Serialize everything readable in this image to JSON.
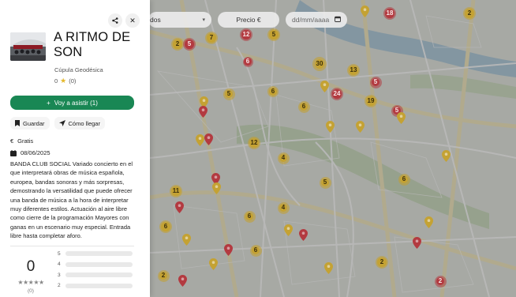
{
  "event": {
    "title": "A RITMO DE SON",
    "venue": "Cúpula Geodésica",
    "rating_count_label": "0",
    "reviews_label": "(0)",
    "attend_label": "Voy a asistir (1)",
    "save_label": "Guardar",
    "directions_label": "Cómo llegar",
    "price": "Gratis",
    "date": "08/06/2025",
    "description": "BANDA CLUB SOCIAL Variado concierto en el que interpretará obras de música española, europea, bandas sonoras y más sorpresas, demostrando la versatilidad que puede ofrecer una banda de música a la hora de interpretar muy diferentes estilos. Actuación al aire libre como cierre de la programación Mayores con ganas en un escenario muy especial. Entrada libre hasta completar aforo."
  },
  "ratings": {
    "average": "0",
    "count_label": "(0)",
    "breakdown": [
      {
        "stars": "5",
        "fraction": 0
      },
      {
        "stars": "4",
        "fraction": 0
      },
      {
        "stars": "3",
        "fraction": 0
      },
      {
        "stars": "2",
        "fraction": 0
      }
    ]
  },
  "map_controls": {
    "category_text": "dos",
    "price_label": "Precio €",
    "date_placeholder": "dd/mm/aaaa"
  },
  "map": {
    "clusters": [
      {
        "label": "2",
        "color": "y"
      },
      {
        "label": "5",
        "color": "r"
      },
      {
        "label": "7",
        "color": "y"
      },
      {
        "label": "12",
        "color": "r"
      },
      {
        "label": "5",
        "color": "y"
      },
      {
        "label": "6",
        "color": "r"
      },
      {
        "label": "18",
        "color": "r"
      },
      {
        "label": "2",
        "color": "y"
      },
      {
        "label": "30",
        "color": "y"
      },
      {
        "label": "13",
        "color": "y"
      },
      {
        "label": "5",
        "color": "y"
      },
      {
        "label": "6",
        "color": "y"
      },
      {
        "label": "24",
        "color": "r"
      },
      {
        "label": "5",
        "color": "r"
      },
      {
        "label": "6",
        "color": "y"
      },
      {
        "label": "19",
        "color": "y"
      },
      {
        "label": "5",
        "color": "r"
      },
      {
        "label": "12",
        "color": "y"
      },
      {
        "label": "4",
        "color": "y"
      },
      {
        "label": "5",
        "color": "y"
      },
      {
        "label": "11",
        "color": "y"
      },
      {
        "label": "6",
        "color": "y"
      },
      {
        "label": "4",
        "color": "y"
      },
      {
        "label": "6",
        "color": "y"
      },
      {
        "label": "6",
        "color": "y"
      },
      {
        "label": "2",
        "color": "y"
      },
      {
        "label": "2",
        "color": "y"
      },
      {
        "label": "2",
        "color": "r"
      },
      {
        "label": "6",
        "color": "y"
      }
    ],
    "colors": {
      "yellow": "#c4a233",
      "red": "#b33a40",
      "green": "#198754"
    }
  }
}
